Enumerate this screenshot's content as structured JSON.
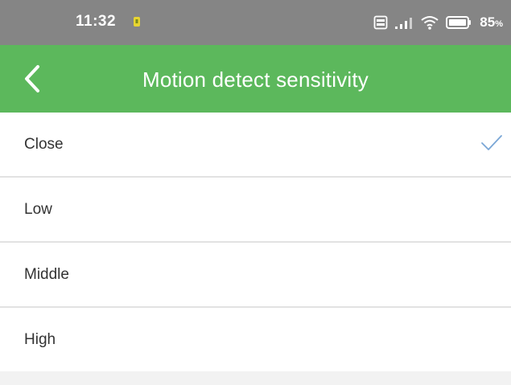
{
  "status_bar": {
    "time": "11:32",
    "battery_percent": "85"
  },
  "header": {
    "title": "Motion detect sensitivity",
    "back_icon": "chevron-left-icon"
  },
  "options": [
    {
      "label": "Close",
      "selected": true
    },
    {
      "label": "Low",
      "selected": false
    },
    {
      "label": "Middle",
      "selected": false
    },
    {
      "label": "High",
      "selected": false
    }
  ],
  "colors": {
    "accent": "#5cb85c",
    "status_bar": "#858585",
    "check": "#7aa7d6"
  }
}
